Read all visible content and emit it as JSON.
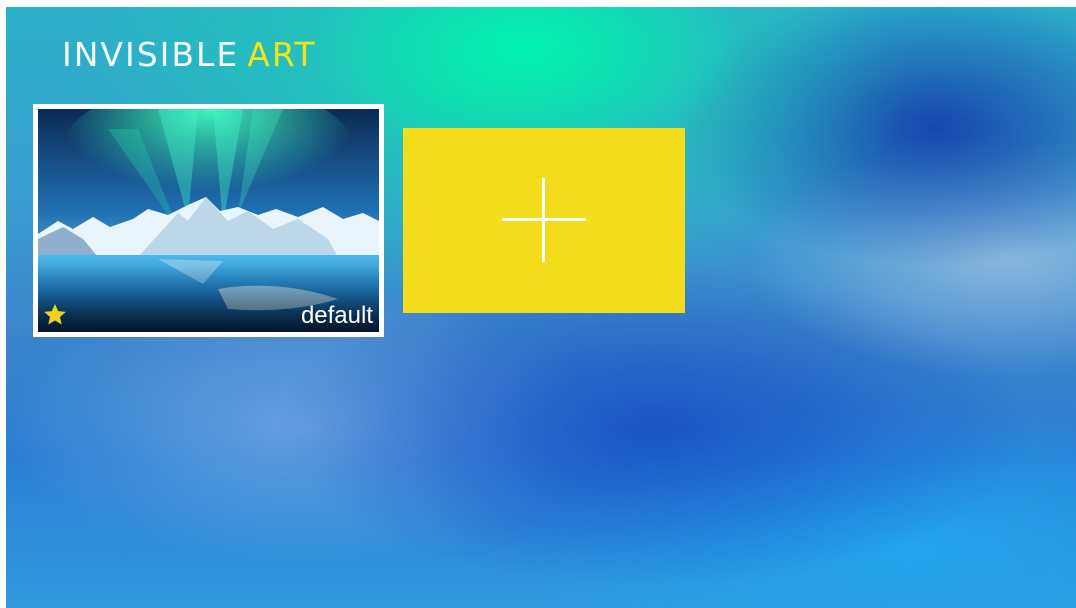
{
  "app": {
    "logo": {
      "primary": "INVISIBLE",
      "accent": "ART"
    }
  },
  "wallpapers": [
    {
      "label": "default",
      "is_default": true,
      "icon": "star-icon"
    }
  ],
  "add_tile": {
    "icon": "plus-icon"
  },
  "colors": {
    "accent_yellow": "#f3dc1b",
    "logo_white": "#f4f8fb",
    "logo_accent": "#f2e41a",
    "frame": "#ffffff"
  }
}
